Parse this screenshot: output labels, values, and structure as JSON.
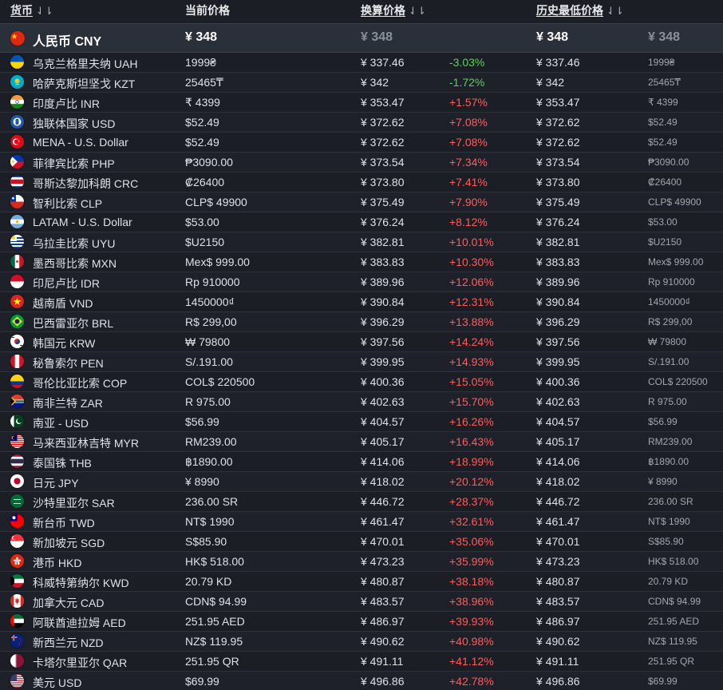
{
  "header": {
    "currency": "货币",
    "current_price": "当前价格",
    "converted_price": "换算价格",
    "lowest_price": "历史最低价格",
    "sort_icon": "⇃⇂"
  },
  "base": {
    "name": "人民币 CNY",
    "price": "¥ 348",
    "converted": "¥ 348",
    "lowest": "¥ 348",
    "lowest_local": "¥ 348"
  },
  "rows": [
    {
      "name": "乌克兰格里夫纳 UAH",
      "price": "1999₴",
      "converted": "¥ 337.46",
      "pct": "-3.03%",
      "lowest": "¥ 337.46",
      "lowest_local": "1999₴",
      "flag": "flag-ukraine-icon"
    },
    {
      "name": "哈萨克斯坦坚戈 KZT",
      "price": "25465₸",
      "converted": "¥ 342",
      "pct": "-1.72%",
      "lowest": "¥ 342",
      "lowest_local": "25465₸",
      "flag": "flag-kazakhstan-icon"
    },
    {
      "name": "印度卢比 INR",
      "price": "₹ 4399",
      "converted": "¥ 353.47",
      "pct": "+1.57%",
      "lowest": "¥ 353.47",
      "lowest_local": "₹ 4399",
      "flag": "flag-india-icon"
    },
    {
      "name": "独联体国家 USD",
      "price": "$52.49",
      "converted": "¥ 372.62",
      "pct": "+7.08%",
      "lowest": "¥ 372.62",
      "lowest_local": "$52.49",
      "flag": "flag-cis-icon"
    },
    {
      "name": "MENA - U.S. Dollar",
      "price": "$52.49",
      "converted": "¥ 372.62",
      "pct": "+7.08%",
      "lowest": "¥ 372.62",
      "lowest_local": "$52.49",
      "flag": "flag-turkey-icon"
    },
    {
      "name": "菲律宾比索 PHP",
      "price": "₱3090.00",
      "converted": "¥ 373.54",
      "pct": "+7.34%",
      "lowest": "¥ 373.54",
      "lowest_local": "₱3090.00",
      "flag": "flag-philippines-icon"
    },
    {
      "name": "哥斯达黎加科朗 CRC",
      "price": "₡26400",
      "converted": "¥ 373.80",
      "pct": "+7.41%",
      "lowest": "¥ 373.80",
      "lowest_local": "₡26400",
      "flag": "flag-costa-rica-icon"
    },
    {
      "name": "智利比索 CLP",
      "price": "CLP$ 49900",
      "converted": "¥ 375.49",
      "pct": "+7.90%",
      "lowest": "¥ 375.49",
      "lowest_local": "CLP$ 49900",
      "flag": "flag-chile-icon"
    },
    {
      "name": "LATAM - U.S. Dollar",
      "price": "$53.00",
      "converted": "¥ 376.24",
      "pct": "+8.12%",
      "lowest": "¥ 376.24",
      "lowest_local": "$53.00",
      "flag": "flag-argentina-icon"
    },
    {
      "name": "乌拉圭比索 UYU",
      "price": "$U2150",
      "converted": "¥ 382.81",
      "pct": "+10.01%",
      "lowest": "¥ 382.81",
      "lowest_local": "$U2150",
      "flag": "flag-uruguay-icon"
    },
    {
      "name": "墨西哥比索 MXN",
      "price": "Mex$ 999.00",
      "converted": "¥ 383.83",
      "pct": "+10.30%",
      "lowest": "¥ 383.83",
      "lowest_local": "Mex$ 999.00",
      "flag": "flag-mexico-icon"
    },
    {
      "name": "印尼卢比 IDR",
      "price": "Rp 910000",
      "converted": "¥ 389.96",
      "pct": "+12.06%",
      "lowest": "¥ 389.96",
      "lowest_local": "Rp 910000",
      "flag": "flag-indonesia-icon"
    },
    {
      "name": "越南盾 VND",
      "price": "1450000₫",
      "converted": "¥ 390.84",
      "pct": "+12.31%",
      "lowest": "¥ 390.84",
      "lowest_local": "1450000₫",
      "flag": "flag-vietnam-icon"
    },
    {
      "name": "巴西雷亚尔 BRL",
      "price": "R$ 299,00",
      "converted": "¥ 396.29",
      "pct": "+13.88%",
      "lowest": "¥ 396.29",
      "lowest_local": "R$ 299,00",
      "flag": "flag-brazil-icon"
    },
    {
      "name": "韩国元 KRW",
      "price": "₩ 79800",
      "converted": "¥ 397.56",
      "pct": "+14.24%",
      "lowest": "¥ 397.56",
      "lowest_local": "₩ 79800",
      "flag": "flag-south-korea-icon"
    },
    {
      "name": "秘鲁索尔 PEN",
      "price": "S/.191.00",
      "converted": "¥ 399.95",
      "pct": "+14.93%",
      "lowest": "¥ 399.95",
      "lowest_local": "S/.191.00",
      "flag": "flag-peru-icon"
    },
    {
      "name": "哥伦比亚比索 COP",
      "price": "COL$ 220500",
      "converted": "¥ 400.36",
      "pct": "+15.05%",
      "lowest": "¥ 400.36",
      "lowest_local": "COL$ 220500",
      "flag": "flag-colombia-icon"
    },
    {
      "name": "南非兰特 ZAR",
      "price": "R 975.00",
      "converted": "¥ 402.63",
      "pct": "+15.70%",
      "lowest": "¥ 402.63",
      "lowest_local": "R 975.00",
      "flag": "flag-south-africa-icon"
    },
    {
      "name": "南亚 - USD",
      "price": "$56.99",
      "converted": "¥ 404.57",
      "pct": "+16.26%",
      "lowest": "¥ 404.57",
      "lowest_local": "$56.99",
      "flag": "flag-pakistan-icon"
    },
    {
      "name": "马来西亚林吉特 MYR",
      "price": "RM239.00",
      "converted": "¥ 405.17",
      "pct": "+16.43%",
      "lowest": "¥ 405.17",
      "lowest_local": "RM239.00",
      "flag": "flag-malaysia-icon"
    },
    {
      "name": "泰国铢 THB",
      "price": "฿1890.00",
      "converted": "¥ 414.06",
      "pct": "+18.99%",
      "lowest": "¥ 414.06",
      "lowest_local": "฿1890.00",
      "flag": "flag-thailand-icon"
    },
    {
      "name": "日元 JPY",
      "price": "¥ 8990",
      "converted": "¥ 418.02",
      "pct": "+20.12%",
      "lowest": "¥ 418.02",
      "lowest_local": "¥ 8990",
      "flag": "flag-japan-icon"
    },
    {
      "name": "沙特里亚尔 SAR",
      "price": "236.00 SR",
      "converted": "¥ 446.72",
      "pct": "+28.37%",
      "lowest": "¥ 446.72",
      "lowest_local": "236.00 SR",
      "flag": "flag-saudi-arabia-icon"
    },
    {
      "name": "新台币 TWD",
      "price": "NT$ 1990",
      "converted": "¥ 461.47",
      "pct": "+32.61%",
      "lowest": "¥ 461.47",
      "lowest_local": "NT$ 1990",
      "flag": "flag-taiwan-icon"
    },
    {
      "name": "新加坡元 SGD",
      "price": "S$85.90",
      "converted": "¥ 470.01",
      "pct": "+35.06%",
      "lowest": "¥ 470.01",
      "lowest_local": "S$85.90",
      "flag": "flag-singapore-icon"
    },
    {
      "name": "港币 HKD",
      "price": "HK$ 518.00",
      "converted": "¥ 473.23",
      "pct": "+35.99%",
      "lowest": "¥ 473.23",
      "lowest_local": "HK$ 518.00",
      "flag": "flag-hong-kong-icon"
    },
    {
      "name": "科威特第纳尔 KWD",
      "price": "20.79 KD",
      "converted": "¥ 480.87",
      "pct": "+38.18%",
      "lowest": "¥ 480.87",
      "lowest_local": "20.79 KD",
      "flag": "flag-kuwait-icon"
    },
    {
      "name": "加拿大元 CAD",
      "price": "CDN$ 94.99",
      "converted": "¥ 483.57",
      "pct": "+38.96%",
      "lowest": "¥ 483.57",
      "lowest_local": "CDN$ 94.99",
      "flag": "flag-canada-icon"
    },
    {
      "name": "阿联酋迪拉姆 AED",
      "price": "251.95 AED",
      "converted": "¥ 486.97",
      "pct": "+39.93%",
      "lowest": "¥ 486.97",
      "lowest_local": "251.95 AED",
      "flag": "flag-uae-icon"
    },
    {
      "name": "新西兰元 NZD",
      "price": "NZ$ 119.95",
      "converted": "¥ 490.62",
      "pct": "+40.98%",
      "lowest": "¥ 490.62",
      "lowest_local": "NZ$ 119.95",
      "flag": "flag-new-zealand-icon"
    },
    {
      "name": "卡塔尔里亚尔 QAR",
      "price": "251.95 QR",
      "converted": "¥ 491.11",
      "pct": "+41.12%",
      "lowest": "¥ 491.11",
      "lowest_local": "251.95 QR",
      "flag": "flag-qatar-icon"
    },
    {
      "name": "美元 USD",
      "price": "$69.99",
      "converted": "¥ 496.86",
      "pct": "+42.78%",
      "lowest": "¥ 496.86",
      "lowest_local": "$69.99",
      "flag": "flag-usa-icon"
    }
  ],
  "colors": {
    "background": "#1b1e25",
    "highlight_row": "#2a303a",
    "negative": "#5bd15f",
    "positive": "#ff5c5c"
  }
}
